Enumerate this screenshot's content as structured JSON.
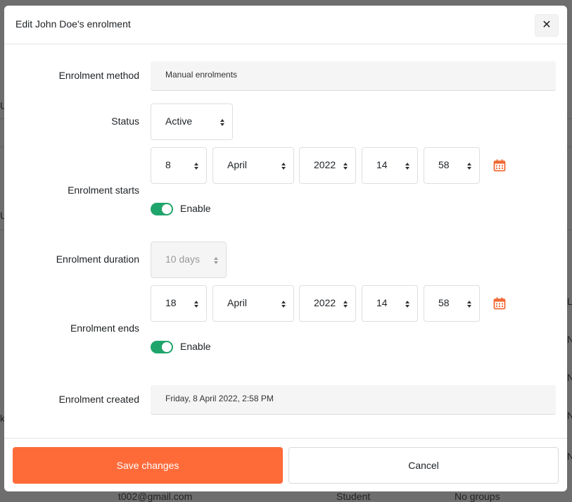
{
  "background": {
    "fragments": [
      "U",
      "U",
      "k",
      "L",
      "N",
      "N",
      "N",
      "N",
      "t002@gmail.com",
      "Student",
      "No groups"
    ]
  },
  "modal": {
    "title": "Edit John Doe's enrolment",
    "close_icon": "close-icon"
  },
  "fields": {
    "method": {
      "label": "Enrolment method",
      "value": "Manual enrolments"
    },
    "status": {
      "label": "Status",
      "value": "Active"
    },
    "starts": {
      "label": "Enrolment starts",
      "day": "8",
      "month": "April",
      "year": "2022",
      "hour": "14",
      "minute": "58",
      "enable_label": "Enable",
      "enabled": true
    },
    "duration": {
      "label": "Enrolment duration",
      "value": "10 days"
    },
    "ends": {
      "label": "Enrolment ends",
      "day": "18",
      "month": "April",
      "year": "2022",
      "hour": "14",
      "minute": "58",
      "enable_label": "Enable",
      "enabled": true
    },
    "created": {
      "label": "Enrolment created",
      "value": "Friday, 8 April 2022, 2:58 PM"
    }
  },
  "footer": {
    "save_label": "Save changes",
    "cancel_label": "Cancel"
  },
  "colors": {
    "primary": "#ff6a39",
    "toggle_on": "#1fa56b",
    "calendar_icon": "#f06a35"
  }
}
